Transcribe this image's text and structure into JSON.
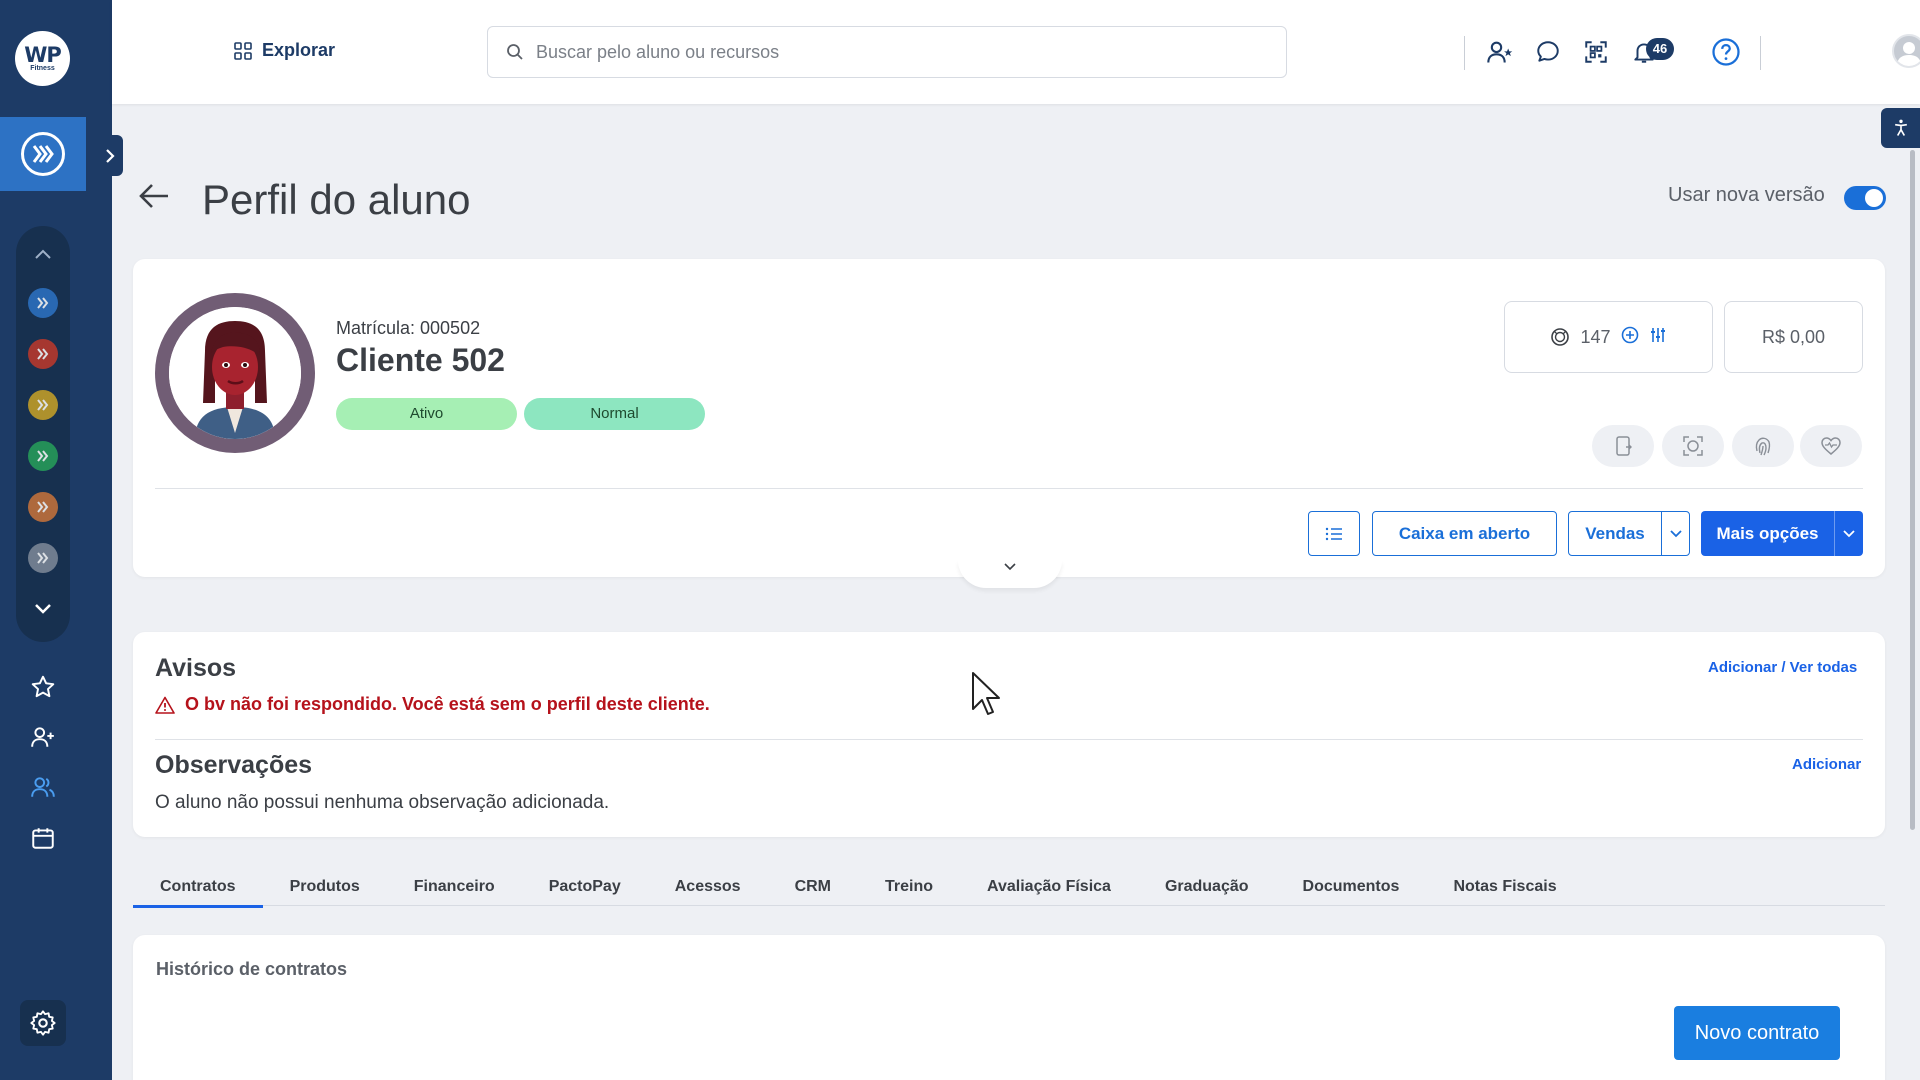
{
  "brand": {
    "logo_main": "WP",
    "logo_sub": "Fitness"
  },
  "topbar": {
    "explorar_label": "Explorar",
    "search_placeholder": "Buscar pelo aluno ou recursos",
    "notifications_count": "46"
  },
  "page": {
    "title": "Perfil do aluno",
    "toggle_label": "Usar nova versão",
    "toggle_on": true
  },
  "profile": {
    "matricula": "Matrícula: 000502",
    "name": "Cliente 502",
    "tags": [
      {
        "label": "Ativo",
        "color": "#a6efb4"
      },
      {
        "label": "Normal",
        "color": "#8de6c0"
      }
    ],
    "points": "147",
    "balance": "R$ 0,00"
  },
  "actions": {
    "caixa_label": "Caixa em aberto",
    "vendas_label": "Vendas",
    "mais_label": "Mais opções"
  },
  "avisos": {
    "title": "Avisos",
    "link": "Adicionar / Ver todas",
    "message": "O bv não foi respondido. Você está sem o perfil deste cliente."
  },
  "observacoes": {
    "title": "Observações",
    "link": "Adicionar",
    "message": "O aluno não possui nenhuma observação adicionada."
  },
  "tabs": [
    {
      "label": "Contratos",
      "active": true
    },
    {
      "label": "Produtos"
    },
    {
      "label": "Financeiro"
    },
    {
      "label": "PactoPay"
    },
    {
      "label": "Acessos"
    },
    {
      "label": "CRM"
    },
    {
      "label": "Treino"
    },
    {
      "label": "Avaliação Física"
    },
    {
      "label": "Graduação"
    },
    {
      "label": "Documentos"
    },
    {
      "label": "Notas Fiscais"
    }
  ],
  "contracts": {
    "title": "Histórico de contratos",
    "new_button": "Novo contrato"
  },
  "colors": {
    "sidebar": "#1d3b66",
    "primary": "#1a62e6",
    "alert": "#b5121b"
  },
  "unit_colors": [
    "#2d72c4",
    "#c0392b",
    "#c9a227",
    "#27a05a",
    "#c9733a",
    "#7f8a99"
  ]
}
